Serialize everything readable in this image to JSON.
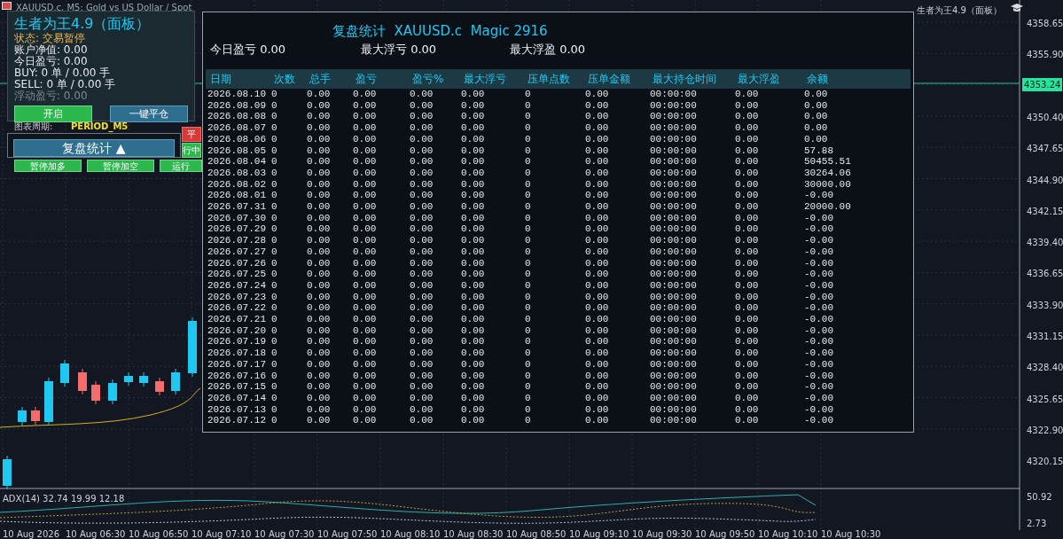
{
  "chart_header": {
    "symbol_title": "XAUUSD.c, M5:  Gold vs US Dollar / Spot",
    "ea_name": "生者为王4.9（面板）"
  },
  "price_axis": {
    "labels": [
      "4358.65",
      "4355.90",
      "4350.40",
      "4347.65",
      "4344.90",
      "4342.15",
      "4339.40",
      "4336.65",
      "4333.90",
      "4331.15",
      "4328.40",
      "4325.65",
      "4322.90",
      "4320.15"
    ],
    "current_price": "4353.24"
  },
  "indicator": {
    "label": "ADX(14) 32.74 19.99 12.18",
    "axis_labels": [
      "50.92",
      "2.73"
    ]
  },
  "time_axis": [
    "10 Aug 2026",
    "10 Aug 06:30",
    "10 Aug 06:50",
    "10 Aug 07:10",
    "10 Aug 07:30",
    "10 Aug 07:50",
    "10 Aug 08:10",
    "10 Aug 08:30",
    "10 Aug 08:50",
    "10 Aug 09:10",
    "10 Aug 09:30",
    "10 Aug 09:50",
    "10 Aug 10:10",
    "10 Aug 10:30"
  ],
  "panel": {
    "title": "生者为王4.9（面板）",
    "lines": [
      {
        "text": "状态: 交易暂停",
        "kind": "status"
      },
      {
        "text": "账户净值: 0.00",
        "kind": "normal"
      },
      {
        "text": "今日盈亏: 0.00",
        "kind": "normal"
      },
      {
        "text": "BUY: 0 单 / 0.00 手",
        "kind": "normal"
      },
      {
        "text": "SELL: 0 单 / 0.00 手",
        "kind": "normal"
      },
      {
        "text": "浮动盈亏: 0.00",
        "kind": "muted"
      }
    ],
    "buttons": [
      {
        "label": "开启",
        "kind": "green"
      },
      {
        "label": "一键平仓",
        "kind": "blue"
      }
    ]
  },
  "back_controls": {
    "period_label": "图表周期:",
    "period_value": "PERIOD_M5",
    "side_buttons": [
      {
        "label": "平",
        "kind": "red"
      },
      {
        "label": "行中",
        "kind": "green"
      }
    ],
    "buttons": [
      {
        "label": "暂停加多",
        "kind": "green"
      },
      {
        "label": "暂停加空",
        "kind": "green"
      },
      {
        "label": "运行",
        "kind": "green"
      }
    ]
  },
  "stats_toggle": {
    "label": "复盘统计 ▲"
  },
  "stats_window": {
    "title": "复盘统计  XAUUSD.c  Magic 2916",
    "summary": [
      "今日盈亏 0.00",
      "最大浮亏 0.00",
      "最大浮盈 0.00"
    ],
    "columns": [
      "日期",
      "次数",
      "总手",
      "盈亏",
      "盈亏%",
      "最大浮亏",
      "压单点数",
      "压单金额",
      "最大持仓时间",
      "最大浮盈",
      "余额"
    ],
    "rows": [
      [
        "2026.08.10",
        "0",
        "0.00",
        "0.00",
        "0.00",
        "0.00",
        "0",
        "0.00",
        "00:00:00",
        "0.00",
        "0.00"
      ],
      [
        "2026.08.09",
        "0",
        "0.00",
        "0.00",
        "0.00",
        "0.00",
        "0",
        "0.00",
        "00:00:00",
        "0.00",
        "0.00"
      ],
      [
        "2026.08.08",
        "0",
        "0.00",
        "0.00",
        "0.00",
        "0.00",
        "0",
        "0.00",
        "00:00:00",
        "0.00",
        "0.00"
      ],
      [
        "2026.08.07",
        "0",
        "0.00",
        "0.00",
        "0.00",
        "0.00",
        "0",
        "0.00",
        "00:00:00",
        "0.00",
        "0.00"
      ],
      [
        "2026.08.06",
        "0",
        "0.00",
        "0.00",
        "0.00",
        "0.00",
        "0",
        "0.00",
        "00:00:00",
        "0.00",
        "0.00"
      ],
      [
        "2026.08.05",
        "0",
        "0.00",
        "0.00",
        "0.00",
        "0.00",
        "0",
        "0.00",
        "00:00:00",
        "0.00",
        "57.88"
      ],
      [
        "2026.08.04",
        "0",
        "0.00",
        "0.00",
        "0.00",
        "0.00",
        "0",
        "0.00",
        "00:00:00",
        "0.00",
        "50455.51"
      ],
      [
        "2026.08.03",
        "0",
        "0.00",
        "0.00",
        "0.00",
        "0.00",
        "0",
        "0.00",
        "00:00:00",
        "0.00",
        "30264.06"
      ],
      [
        "2026.08.02",
        "0",
        "0.00",
        "0.00",
        "0.00",
        "0.00",
        "0",
        "0.00",
        "00:00:00",
        "0.00",
        "30000.00"
      ],
      [
        "2026.08.01",
        "0",
        "0.00",
        "0.00",
        "0.00",
        "0.00",
        "0",
        "0.00",
        "00:00:00",
        "0.00",
        "-0.00"
      ],
      [
        "2026.07.31",
        "0",
        "0.00",
        "0.00",
        "0.00",
        "0.00",
        "0",
        "0.00",
        "00:00:00",
        "0.00",
        "20000.00"
      ],
      [
        "2026.07.30",
        "0",
        "0.00",
        "0.00",
        "0.00",
        "0.00",
        "0",
        "0.00",
        "00:00:00",
        "0.00",
        "-0.00"
      ],
      [
        "2026.07.29",
        "0",
        "0.00",
        "0.00",
        "0.00",
        "0.00",
        "0",
        "0.00",
        "00:00:00",
        "0.00",
        "-0.00"
      ],
      [
        "2026.07.28",
        "0",
        "0.00",
        "0.00",
        "0.00",
        "0.00",
        "0",
        "0.00",
        "00:00:00",
        "0.00",
        "-0.00"
      ],
      [
        "2026.07.27",
        "0",
        "0.00",
        "0.00",
        "0.00",
        "0.00",
        "0",
        "0.00",
        "00:00:00",
        "0.00",
        "-0.00"
      ],
      [
        "2026.07.26",
        "0",
        "0.00",
        "0.00",
        "0.00",
        "0.00",
        "0",
        "0.00",
        "00:00:00",
        "0.00",
        "-0.00"
      ],
      [
        "2026.07.25",
        "0",
        "0.00",
        "0.00",
        "0.00",
        "0.00",
        "0",
        "0.00",
        "00:00:00",
        "0.00",
        "-0.00"
      ],
      [
        "2026.07.24",
        "0",
        "0.00",
        "0.00",
        "0.00",
        "0.00",
        "0",
        "0.00",
        "00:00:00",
        "0.00",
        "-0.00"
      ],
      [
        "2026.07.23",
        "0",
        "0.00",
        "0.00",
        "0.00",
        "0.00",
        "0",
        "0.00",
        "00:00:00",
        "0.00",
        "-0.00"
      ],
      [
        "2026.07.22",
        "0",
        "0.00",
        "0.00",
        "0.00",
        "0.00",
        "0",
        "0.00",
        "00:00:00",
        "0.00",
        "-0.00"
      ],
      [
        "2026.07.21",
        "0",
        "0.00",
        "0.00",
        "0.00",
        "0.00",
        "0",
        "0.00",
        "00:00:00",
        "0.00",
        "-0.00"
      ],
      [
        "2026.07.20",
        "0",
        "0.00",
        "0.00",
        "0.00",
        "0.00",
        "0",
        "0.00",
        "00:00:00",
        "0.00",
        "-0.00"
      ],
      [
        "2026.07.19",
        "0",
        "0.00",
        "0.00",
        "0.00",
        "0.00",
        "0",
        "0.00",
        "00:00:00",
        "0.00",
        "-0.00"
      ],
      [
        "2026.07.18",
        "0",
        "0.00",
        "0.00",
        "0.00",
        "0.00",
        "0",
        "0.00",
        "00:00:00",
        "0.00",
        "-0.00"
      ],
      [
        "2026.07.17",
        "0",
        "0.00",
        "0.00",
        "0.00",
        "0.00",
        "0",
        "0.00",
        "00:00:00",
        "0.00",
        "-0.00"
      ],
      [
        "2026.07.16",
        "0",
        "0.00",
        "0.00",
        "0.00",
        "0.00",
        "0",
        "0.00",
        "00:00:00",
        "0.00",
        "-0.00"
      ],
      [
        "2026.07.15",
        "0",
        "0.00",
        "0.00",
        "0.00",
        "0.00",
        "0",
        "0.00",
        "00:00:00",
        "0.00",
        "-0.00"
      ],
      [
        "2026.07.14",
        "0",
        "0.00",
        "0.00",
        "0.00",
        "0.00",
        "0",
        "0.00",
        "00:00:00",
        "0.00",
        "-0.00"
      ],
      [
        "2026.07.13",
        "0",
        "0.00",
        "0.00",
        "0.00",
        "0.00",
        "0",
        "0.00",
        "00:00:00",
        "0.00",
        "-0.00"
      ],
      [
        "2026.07.12",
        "0",
        "0.00",
        "0.00",
        "0.00",
        "0.00",
        "0",
        "0.00",
        "00:00:00",
        "0.00",
        "-0.00"
      ]
    ]
  }
}
